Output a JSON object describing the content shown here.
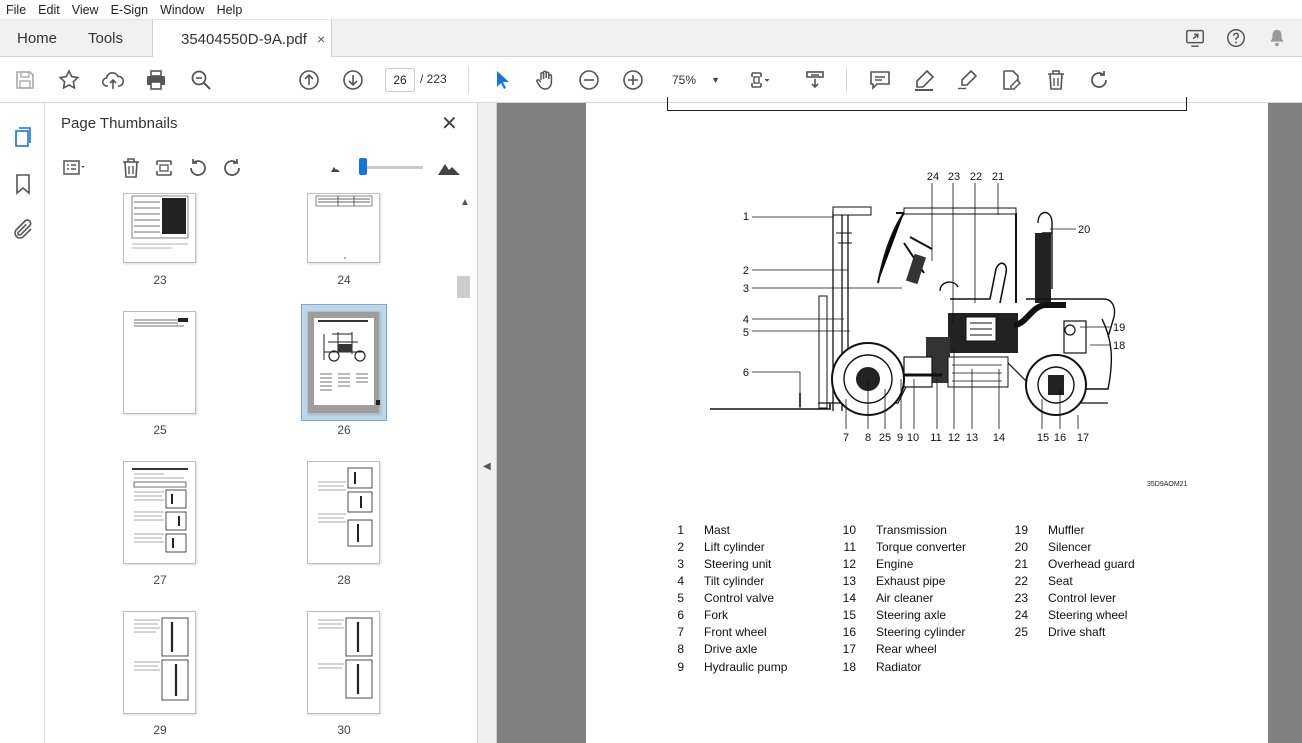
{
  "menu": [
    "File",
    "Edit",
    "View",
    "E-Sign",
    "Window",
    "Help"
  ],
  "tabs": {
    "home": "Home",
    "tools": "Tools",
    "document": "35404550D-9A.pdf",
    "close": "×"
  },
  "toolbar": {
    "current_page": "26",
    "total_pages": "/ 223",
    "zoom": "75%"
  },
  "panel": {
    "title": "Page Thumbnails",
    "close": "✕"
  },
  "thumbnails": [
    {
      "label": "23"
    },
    {
      "label": "24"
    },
    {
      "label": "25"
    },
    {
      "label": "26",
      "selected": true
    },
    {
      "label": "27"
    },
    {
      "label": "28"
    },
    {
      "label": "29"
    },
    {
      "label": "30"
    }
  ],
  "diagram": {
    "callouts": [
      "1",
      "2",
      "3",
      "4",
      "5",
      "6",
      "7",
      "8",
      "25",
      "9",
      "10",
      "11",
      "12",
      "13",
      "14",
      "15",
      "16",
      "17",
      "18",
      "19",
      "20",
      "21",
      "22",
      "23",
      "24"
    ],
    "figure_code": "35D9AOM21"
  },
  "legend": {
    "col1": [
      {
        "num": "1",
        "name": "Mast"
      },
      {
        "num": "2",
        "name": "Lift cylinder"
      },
      {
        "num": "3",
        "name": "Steering unit"
      },
      {
        "num": "4",
        "name": "Tilt cylinder"
      },
      {
        "num": "5",
        "name": "Control valve"
      },
      {
        "num": "6",
        "name": "Fork"
      },
      {
        "num": "7",
        "name": "Front wheel"
      },
      {
        "num": "8",
        "name": "Drive axle"
      },
      {
        "num": "9",
        "name": "Hydraulic pump"
      }
    ],
    "col2": [
      {
        "num": "10",
        "name": "Transmission"
      },
      {
        "num": "11",
        "name": "Torque converter"
      },
      {
        "num": "12",
        "name": "Engine"
      },
      {
        "num": "13",
        "name": "Exhaust pipe"
      },
      {
        "num": "14",
        "name": "Air cleaner"
      },
      {
        "num": "15",
        "name": "Steering axle"
      },
      {
        "num": "16",
        "name": "Steering cylinder"
      },
      {
        "num": "17",
        "name": "Rear wheel"
      },
      {
        "num": "18",
        "name": "Radiator"
      }
    ],
    "col3": [
      {
        "num": "19",
        "name": "Muffler"
      },
      {
        "num": "20",
        "name": "Silencer"
      },
      {
        "num": "21",
        "name": "Overhead guard"
      },
      {
        "num": "22",
        "name": "Seat"
      },
      {
        "num": "23",
        "name": "Control lever"
      },
      {
        "num": "24",
        "name": "Steering wheel"
      },
      {
        "num": "25",
        "name": "Drive shaft"
      }
    ]
  },
  "colors": {
    "accent": "#1473e6",
    "panel_bg": "#ffffff",
    "doc_bg": "#808080"
  }
}
